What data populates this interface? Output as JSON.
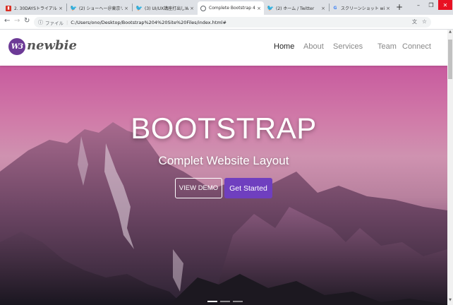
{
  "browser": {
    "tabs": [
      {
        "label": "2. 30DAYSトライアル【Boot…",
        "icon": "bookmark-red",
        "color": "#d93025"
      },
      {
        "label": "(2) ショーヘー＠東京リOMOC…",
        "icon": "twitter",
        "color": "#1da1f2"
      },
      {
        "label": "(3) UI/UX講座打出しWEBデザ…",
        "icon": "twitter",
        "color": "#1da1f2"
      },
      {
        "label": "Complete Bootstrap 4 W…",
        "icon": "globe",
        "color": "#5f6368"
      },
      {
        "label": "(2) ホーム / Twitter",
        "icon": "twitter",
        "color": "#1da1f2"
      },
      {
        "label": "スクリーンショット windows7…",
        "icon": "google",
        "color": "#4285f4"
      }
    ],
    "active_tab": 3,
    "address": {
      "scheme_label": "ファイル",
      "url": "C:/Users/ono/Desktop/Bootstrap%204%20Site%20Files/index.html#"
    }
  },
  "site": {
    "logo_mark": "W3",
    "logo_text": "newbie",
    "nav": [
      {
        "label": "Home",
        "active": true
      },
      {
        "label": "About",
        "active": false
      },
      {
        "label": "Services",
        "active": false
      },
      {
        "label": "Team",
        "active": false
      },
      {
        "label": "Connect",
        "active": false
      }
    ],
    "hero": {
      "title": "BOOTSTRAP",
      "subtitle": "Complet Website Layout",
      "btn_demo": "VIEW DEMO",
      "btn_start": "Get Started",
      "slides": 3,
      "active_slide": 0
    },
    "colors": {
      "accent": "#6f3fbf",
      "logo": "#6c3a96"
    }
  }
}
